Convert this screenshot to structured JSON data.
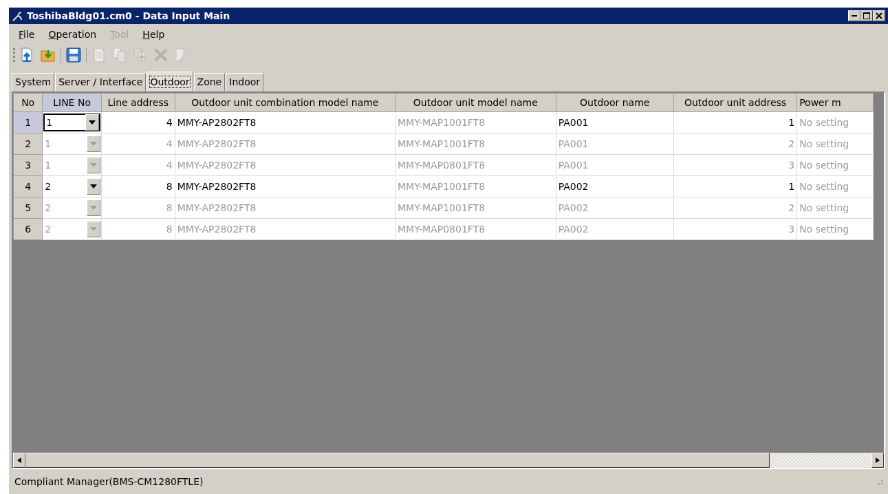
{
  "window": {
    "title": "ToshibaBldg01.cm0 - Data Input Main"
  },
  "menu": [
    {
      "label": "File",
      "disabled": false
    },
    {
      "label": "Operation",
      "disabled": false
    },
    {
      "label": "Tool",
      "disabled": true
    },
    {
      "label": "Help",
      "disabled": false
    }
  ],
  "toolbar": [
    {
      "kind": "open-up",
      "disabled": false
    },
    {
      "kind": "folder-down",
      "disabled": false
    },
    {
      "kind": "sep"
    },
    {
      "kind": "save",
      "disabled": false
    },
    {
      "kind": "sep"
    },
    {
      "kind": "new",
      "disabled": true
    },
    {
      "kind": "copy",
      "disabled": true
    },
    {
      "kind": "paste",
      "disabled": true
    },
    {
      "kind": "delete",
      "disabled": true
    },
    {
      "kind": "edit",
      "disabled": true
    }
  ],
  "tabs": [
    {
      "label": "System",
      "selected": false
    },
    {
      "label": "Server / Interface",
      "selected": false
    },
    {
      "label": "Outdoor",
      "selected": true
    },
    {
      "label": "Zone",
      "selected": false
    },
    {
      "label": "Indoor",
      "selected": false
    }
  ],
  "table": {
    "columns": [
      {
        "label": "No",
        "selected": false
      },
      {
        "label": "LINE No",
        "selected": true
      },
      {
        "label": "Line address",
        "selected": false
      },
      {
        "label": "Outdoor unit combination model name",
        "selected": false
      },
      {
        "label": "Outdoor unit model name",
        "selected": false
      },
      {
        "label": "Outdoor name",
        "selected": false
      },
      {
        "label": "Outdoor unit address",
        "selected": false
      },
      {
        "label": "Power m",
        "selected": false
      }
    ],
    "rows": [
      {
        "no": "1",
        "line_no": "1",
        "line_address": "4",
        "combination_model": "MMY-AP2802FT8",
        "unit_model": "MMY-MAP1001FT8",
        "outdoor_name": "PA001",
        "unit_address": "1",
        "power": "No setting",
        "selected": true,
        "disabled": false
      },
      {
        "no": "2",
        "line_no": "1",
        "line_address": "4",
        "combination_model": "MMY-AP2802FT8",
        "unit_model": "MMY-MAP1001FT8",
        "outdoor_name": "PA001",
        "unit_address": "2",
        "power": "No setting",
        "selected": false,
        "disabled": true
      },
      {
        "no": "3",
        "line_no": "1",
        "line_address": "4",
        "combination_model": "MMY-AP2802FT8",
        "unit_model": "MMY-MAP0801FT8",
        "outdoor_name": "PA001",
        "unit_address": "3",
        "power": "No setting",
        "selected": false,
        "disabled": true
      },
      {
        "no": "4",
        "line_no": "2",
        "line_address": "8",
        "combination_model": "MMY-AP2802FT8",
        "unit_model": "MMY-MAP1001FT8",
        "outdoor_name": "PA002",
        "unit_address": "1",
        "power": "No setting",
        "selected": false,
        "disabled": false
      },
      {
        "no": "5",
        "line_no": "2",
        "line_address": "8",
        "combination_model": "MMY-AP2802FT8",
        "unit_model": "MMY-MAP1001FT8",
        "outdoor_name": "PA002",
        "unit_address": "2",
        "power": "No setting",
        "selected": false,
        "disabled": true
      },
      {
        "no": "6",
        "line_no": "2",
        "line_address": "8",
        "combination_model": "MMY-AP2802FT8",
        "unit_model": "MMY-MAP0801FT8",
        "outdoor_name": "PA002",
        "unit_address": "3",
        "power": "No setting",
        "selected": false,
        "disabled": true
      }
    ]
  },
  "status_bar": {
    "text": "Compliant Manager(BMS-CM1280FTLE)"
  }
}
